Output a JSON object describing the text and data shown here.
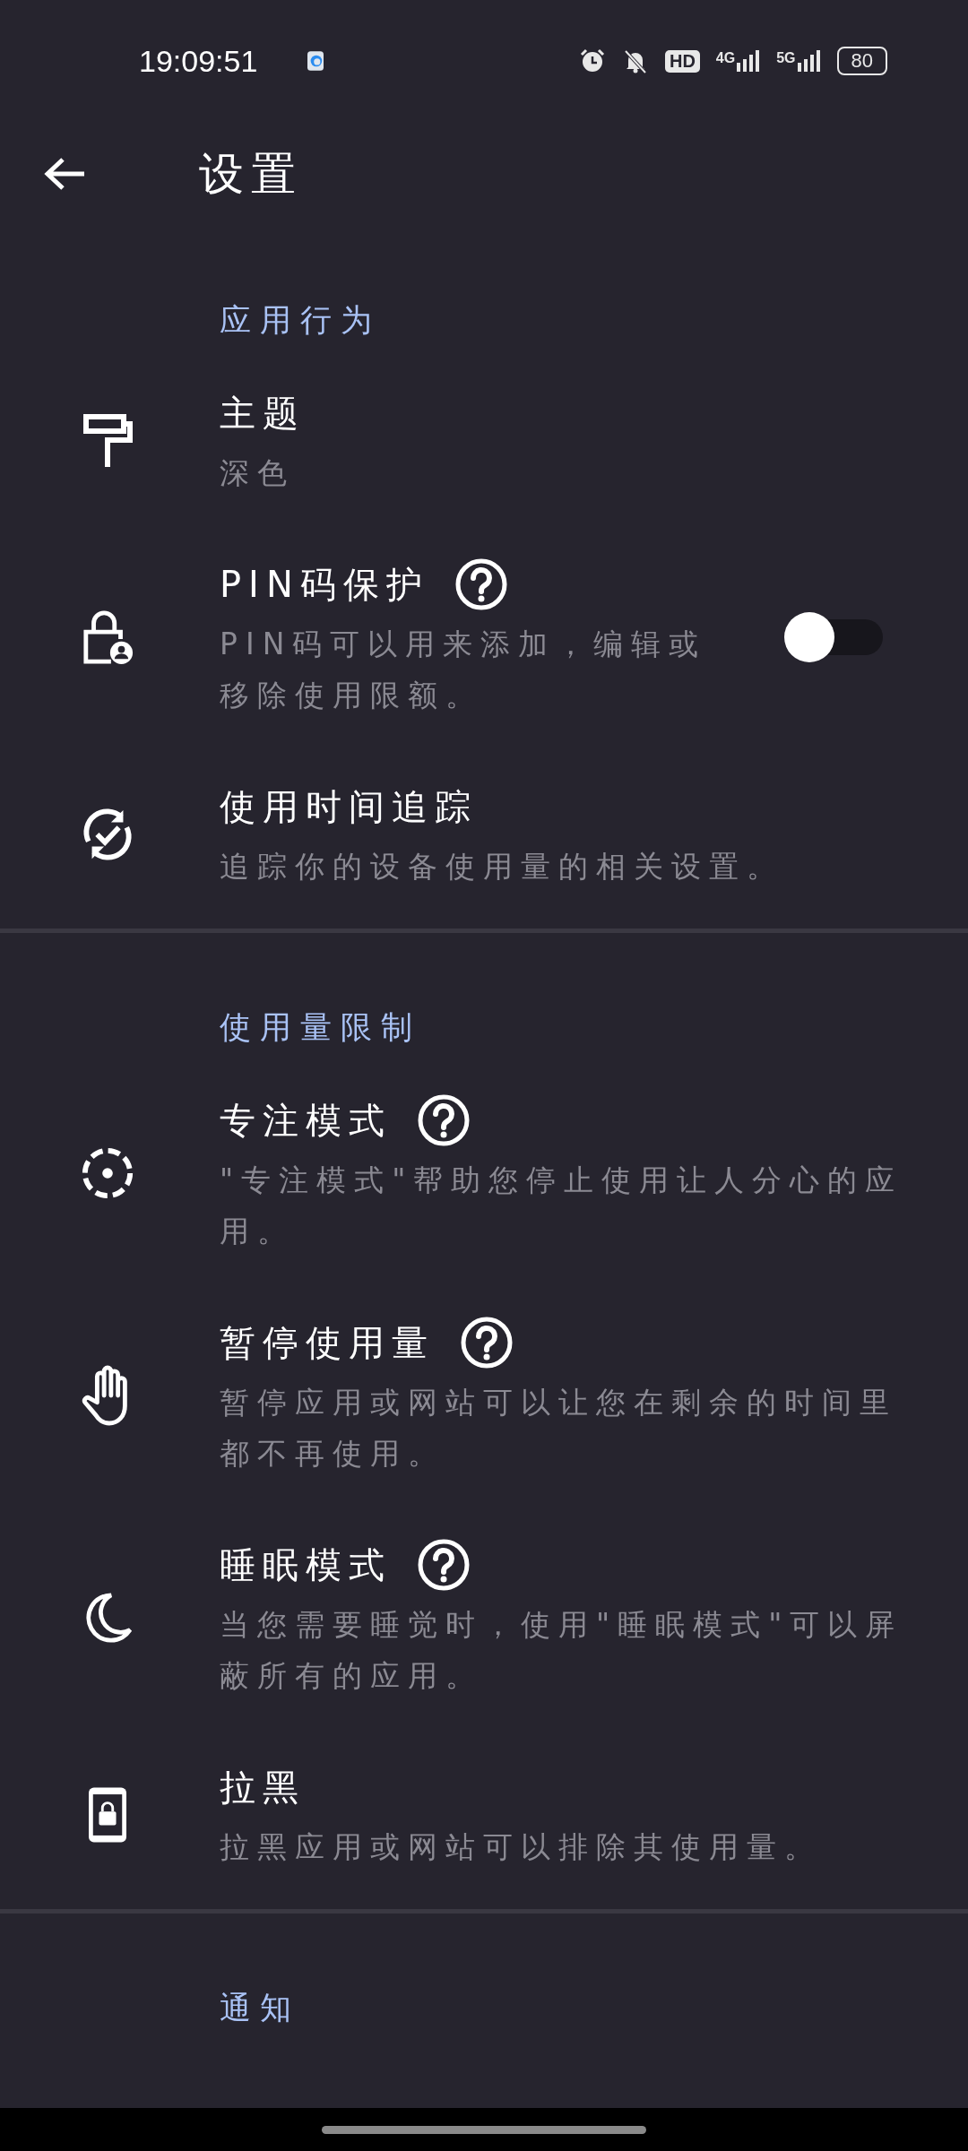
{
  "status_bar": {
    "time": "19:09:51",
    "hd": "HD",
    "networks": [
      "4G",
      "5G"
    ],
    "battery": "80"
  },
  "app_bar": {
    "title": "设置"
  },
  "sections": [
    {
      "header": "应用行为",
      "items": [
        {
          "kind": "plain",
          "title": "主题",
          "subtitle": "深色",
          "help": false
        },
        {
          "kind": "switch",
          "title": "PIN码保护",
          "subtitle": "PIN码可以用来添加，编辑或移除使用限额。",
          "help": true,
          "on": false
        },
        {
          "kind": "plain",
          "title": "使用时间追踪",
          "subtitle": "追踪你的设备使用量的相关设置。",
          "help": false
        }
      ]
    },
    {
      "header": "使用量限制",
      "items": [
        {
          "kind": "plain",
          "title": "专注模式",
          "subtitle": "\"专注模式\"帮助您停止使用让人分心的应用。",
          "help": true
        },
        {
          "kind": "plain",
          "title": "暂停使用量",
          "subtitle": "暂停应用或网站可以让您在剩余的时间里都不再使用。",
          "help": true
        },
        {
          "kind": "plain",
          "title": "睡眠模式",
          "subtitle": "当您需要睡觉时，使用\"睡眠模式\"可以屏蔽所有的应用。",
          "help": true
        },
        {
          "kind": "plain",
          "title": "拉黑",
          "subtitle": "拉黑应用或网站可以排除其使用量。",
          "help": false
        }
      ]
    },
    {
      "header": "通知"
    }
  ]
}
